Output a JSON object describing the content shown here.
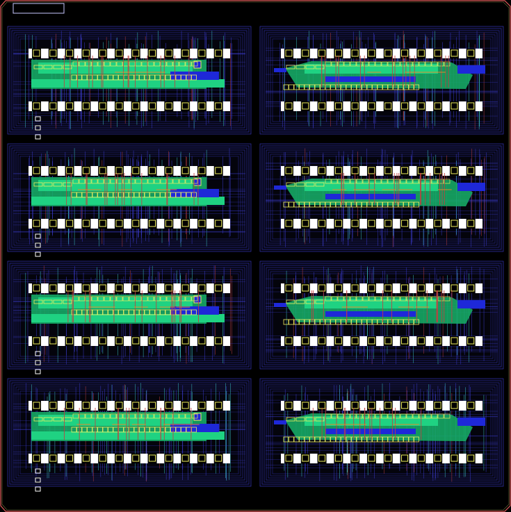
{
  "view": {
    "background": "#000000",
    "die_outline_color": "#e05a5a",
    "inner_outline_color": "#c8c864",
    "title_box_color": "#4a5cff"
  },
  "blocks": {
    "count": 8,
    "columns": 2,
    "rows": 4,
    "variants": [
      "left-variant",
      "right-variant"
    ],
    "pads_per_row_left": 12,
    "pads_per_row_right": 12
  },
  "colors": {
    "boundary_lines": "#3c3cd0",
    "metal_blue": "#1e28d8",
    "metal_green": "#1fd282",
    "metal_green_dark": "#16a864",
    "cell_outline": "#f0f060",
    "pad_fill": "#000000",
    "pad_band": "#ffffff",
    "poly_red": "#c04040",
    "via_cyan": "#3cc8c8",
    "accent_orange": "#e08a2a"
  },
  "icons": {
    "pad": "square-pad",
    "cell": "standard-cell"
  }
}
